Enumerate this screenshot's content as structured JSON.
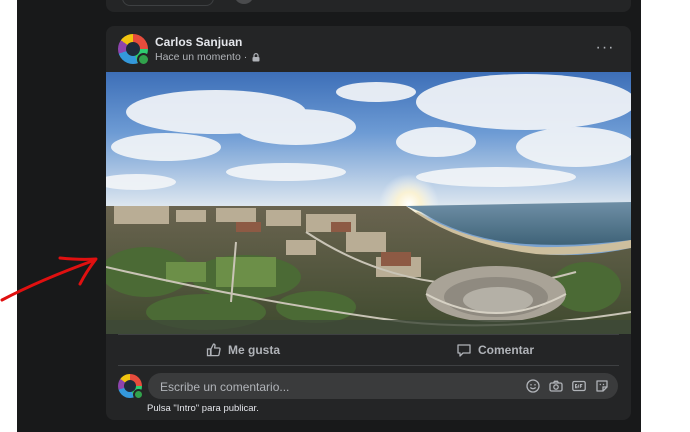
{
  "post": {
    "author": "Carlos Sanjuan",
    "timestamp": "Hace un momento",
    "separator": "·",
    "privacy_icon": "lock-icon",
    "more_label": "···"
  },
  "actions": {
    "like_label": "Me gusta",
    "comment_label": "Comentar"
  },
  "comment": {
    "placeholder": "Escribe un comentario...",
    "hint": "Pulsa \"Intro\" para publicar.",
    "icons": [
      "emoji-icon",
      "camera-icon",
      "gif-icon",
      "sticker-icon"
    ]
  },
  "colors": {
    "feed_bg": "#18191a",
    "card_bg": "#242526",
    "text_primary": "#e4e6eb",
    "text_secondary": "#b0b3b8",
    "online": "#31a24c",
    "annotation_arrow": "#e01010"
  }
}
